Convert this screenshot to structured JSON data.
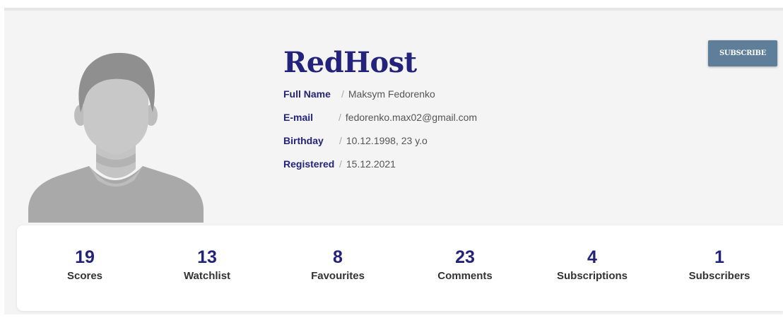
{
  "profile": {
    "username": "RedHost",
    "subscribe_label": "SUBSCRIBE",
    "avatar_icon": "default-user-avatar",
    "info": [
      {
        "label": "Full Name",
        "separator": "/",
        "value": "Maksym Fedorenko"
      },
      {
        "label": "E-mail",
        "separator": "/",
        "value": "fedorenko.max02@gmail.com"
      },
      {
        "label": "Birthday",
        "separator": "/",
        "value": "10.12.1998, 23 y.o"
      },
      {
        "label": "Registered",
        "separator": "/",
        "value": "15.12.2021"
      }
    ]
  },
  "stats": [
    {
      "value": "19",
      "label": "Scores"
    },
    {
      "value": "13",
      "label": "Watchlist"
    },
    {
      "value": "8",
      "label": "Favourites"
    },
    {
      "value": "23",
      "label": "Comments"
    },
    {
      "value": "4",
      "label": "Subscriptions"
    },
    {
      "value": "1",
      "label": "Subscribers"
    }
  ],
  "colors": {
    "accent": "#23237c",
    "button": "#5e7e99",
    "panel_bg": "#f4f4f4"
  }
}
